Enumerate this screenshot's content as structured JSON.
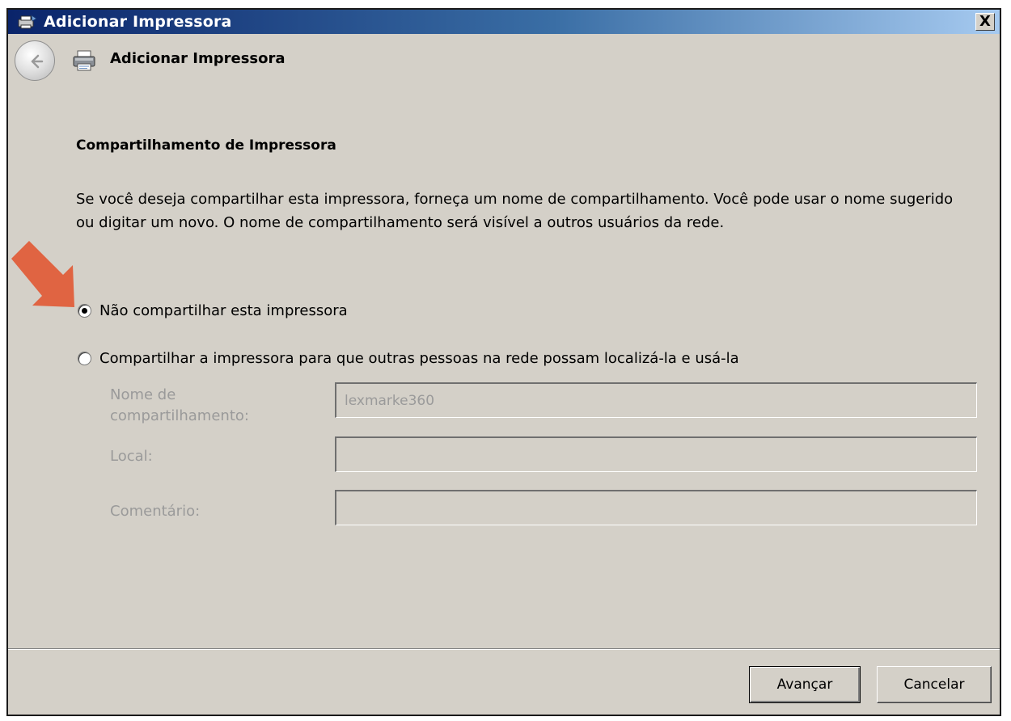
{
  "window": {
    "title": "Adicionar Impressora",
    "close_label": "X"
  },
  "nav": {
    "title": "Adicionar Impressora"
  },
  "section": {
    "title": "Compartilhamento de Impressora",
    "description": "Se você deseja compartilhar esta impressora, forneça um nome de compartilhamento. Você pode usar o nome sugerido ou digitar um novo. O nome de compartilhamento será visível a outros usuários da rede."
  },
  "options": {
    "no_share": {
      "label": "Não compartilhar esta impressora",
      "selected": true
    },
    "share": {
      "label": "Compartilhar a impressora para que outras pessoas na rede possam localizá-la e usá-la",
      "selected": false
    }
  },
  "fields": {
    "share_name": {
      "label_line1": "Nome de",
      "label_line2": "compartilhamento:",
      "value": "lexmarke360"
    },
    "location": {
      "label": "Local:",
      "value": ""
    },
    "comment": {
      "label": "Comentário:",
      "value": ""
    }
  },
  "buttons": {
    "next": "Avançar",
    "cancel": "Cancelar"
  },
  "colors": {
    "dialog_bg": "#d4d0c8",
    "titlebar_start": "#0a246a",
    "titlebar_end": "#a6caf0",
    "annotation_arrow": "#e06442",
    "disabled_text": "#9a9a9a"
  },
  "icons": {
    "title": "printer-wizard-icon",
    "back": "back-arrow-icon",
    "nav": "printer-icon",
    "annotation": "annotation-arrow-icon"
  }
}
